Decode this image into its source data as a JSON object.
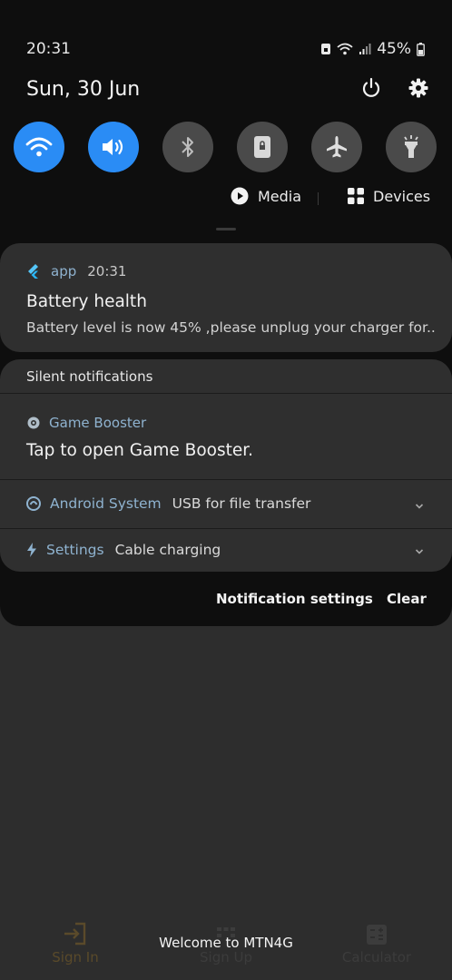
{
  "status_bar": {
    "time": "20:31",
    "battery_percent": "45%",
    "icons": [
      "vpn-lock-icon",
      "wifi-icon",
      "signal-icon",
      "battery-icon"
    ]
  },
  "header": {
    "date": "Sun, 30 Jun",
    "power_icon": "power-icon",
    "settings_icon": "gear-icon"
  },
  "quick_settings": [
    {
      "name": "wifi",
      "icon": "wifi-icon",
      "on": true
    },
    {
      "name": "sound",
      "icon": "volume-icon",
      "on": true
    },
    {
      "name": "bluetooth",
      "icon": "bluetooth-icon",
      "on": false
    },
    {
      "name": "portrait",
      "icon": "portrait-lock-icon",
      "on": false
    },
    {
      "name": "airplane",
      "icon": "airplane-icon",
      "on": false
    },
    {
      "name": "flashlight",
      "icon": "flashlight-icon",
      "on": false
    }
  ],
  "media_bar": {
    "media_label": "Media",
    "devices_label": "Devices"
  },
  "notification": {
    "app": "app",
    "time": "20:31",
    "title": "Battery health",
    "body": "Battery level is now 45% ,please unplug your charger for.."
  },
  "silent": {
    "header": "Silent notifications",
    "game_booster": {
      "app": "Game Booster",
      "body": "Tap to open Game Booster."
    },
    "android_system": {
      "app": "Android System",
      "text": "USB for file transfer"
    },
    "settings": {
      "app": "Settings",
      "text": "Cable charging"
    }
  },
  "actions": {
    "notification_settings": "Notification settings",
    "clear": "Clear"
  },
  "background_app": {
    "toast": "Welcome to MTN4G",
    "nav": [
      {
        "label": "Sign In",
        "icon": "login-icon",
        "color": "#5a4a2a"
      },
      {
        "label": "Sign Up",
        "icon": "grid-icon",
        "color": "#3c3c3c"
      },
      {
        "label": "Calculator",
        "icon": "calculator-icon",
        "color": "#3c3c3c"
      }
    ]
  },
  "colors": {
    "accent": "#2a8cf5",
    "shade_bg": "#0e0e0e",
    "card_bg": "#2f2f2f",
    "app_name": "#8fb3d0"
  }
}
